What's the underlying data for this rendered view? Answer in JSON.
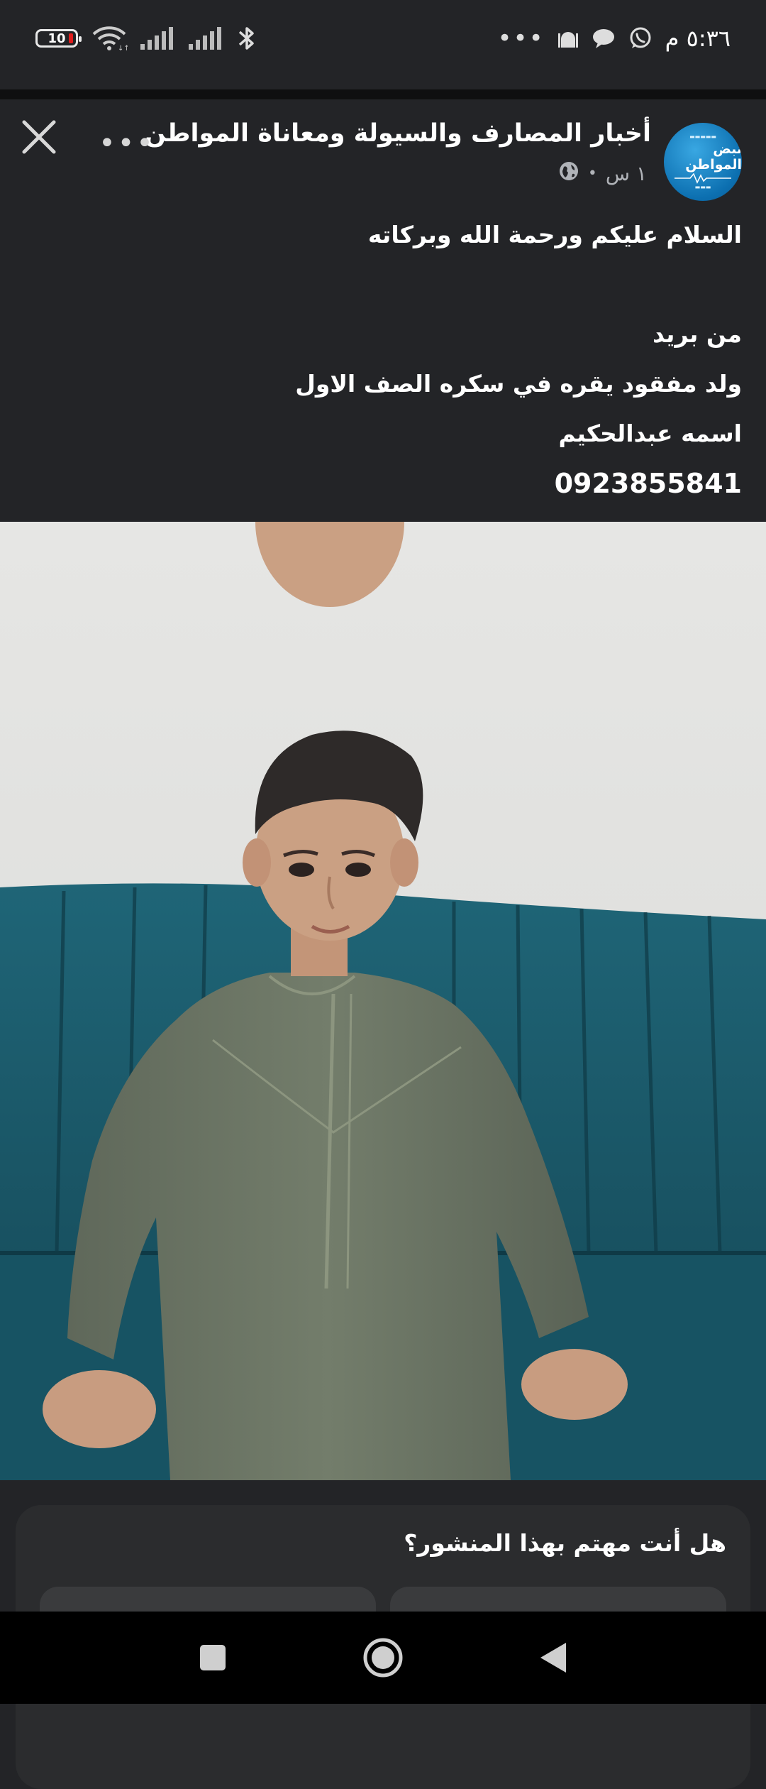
{
  "status_bar": {
    "time": "٥:٣٦ م",
    "battery": "10",
    "overflow": "•••",
    "icons": [
      "mosque-icon",
      "chat-bubble-icon",
      "whatsapp-icon",
      "bluetooth-icon",
      "signal-icon",
      "signal-icon",
      "wifi-icon"
    ]
  },
  "post": {
    "page_name": "أخبار المصارف والسيولة ومعاناة المواطن",
    "time_ago": "١ س",
    "avatar": {
      "brand": "نبض المواطن"
    },
    "text_lines": [
      "السلام عليكم ورحمة الله وبركاته",
      "",
      "من بريد",
      "ولد مفقود يقره في سكره الصف الاول",
      "اسمه عبدالحكيم",
      "0923855841"
    ]
  },
  "interest": {
    "question": "هل أنت مهتم بهذا المنشور؟"
  },
  "nav": {
    "icons": [
      "recents-square-icon",
      "home-circle-icon",
      "back-triangle-icon"
    ]
  },
  "colors": {
    "background": "#232427",
    "card": "#2b2c2e",
    "sofa": "#1b5a6b",
    "robe": "#6b7563",
    "avatar_blue": "#1582c6",
    "battery_low": "#e01d1d"
  }
}
